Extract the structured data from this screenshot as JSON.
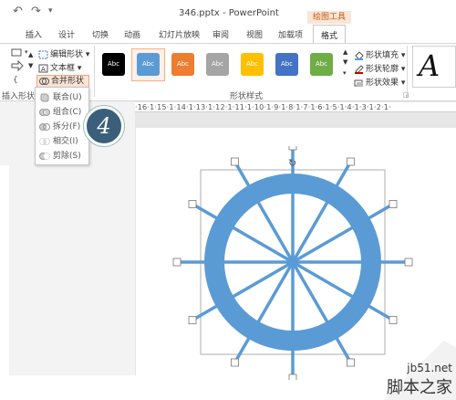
{
  "titlebar": {
    "undo_icon": "undo-icon",
    "redo_icon": "redo-icon",
    "doc_title": "346.pptx - PowerPoint",
    "tool_group": "绘图工具"
  },
  "tabs": [
    "插入",
    "设计",
    "切换",
    "动画",
    "幻灯片放映",
    "审阅",
    "视图",
    "加载项",
    "格式"
  ],
  "active_tab": "格式",
  "ribbon": {
    "edit_shape": "编辑形状",
    "textbox": "文本框",
    "merge_shapes": "合并形状",
    "insert_shapes_label": "插入形状",
    "shape_styles_label": "形状样式",
    "shape_fill": "形状填充",
    "shape_outline": "形状轮廓",
    "shape_effects": "形状效果",
    "swatch_text": "Abc",
    "swatch_colors": [
      "#000000",
      "#5b9bd5",
      "#ed7d31",
      "#a5a5a5",
      "#ffc000",
      "#4472c4",
      "#70ad47"
    ]
  },
  "merge_menu": {
    "items": [
      "联合(U)",
      "组合(C)",
      "拆分(F)",
      "相交(I)",
      "剪除(S)"
    ]
  },
  "step_badge": "4",
  "ruler_text": "·16·1·15·1·14·1·13·1·12·1·11·1·10·1·9·1·8·1·7·1·6·1·5·1·4·1·3·1·2·1·",
  "shape": {
    "ring_color": "#5b9bd5",
    "spoke_color": "#5b9bd5"
  },
  "watermark": {
    "url": "jb51.net",
    "name": "脚本之家"
  }
}
